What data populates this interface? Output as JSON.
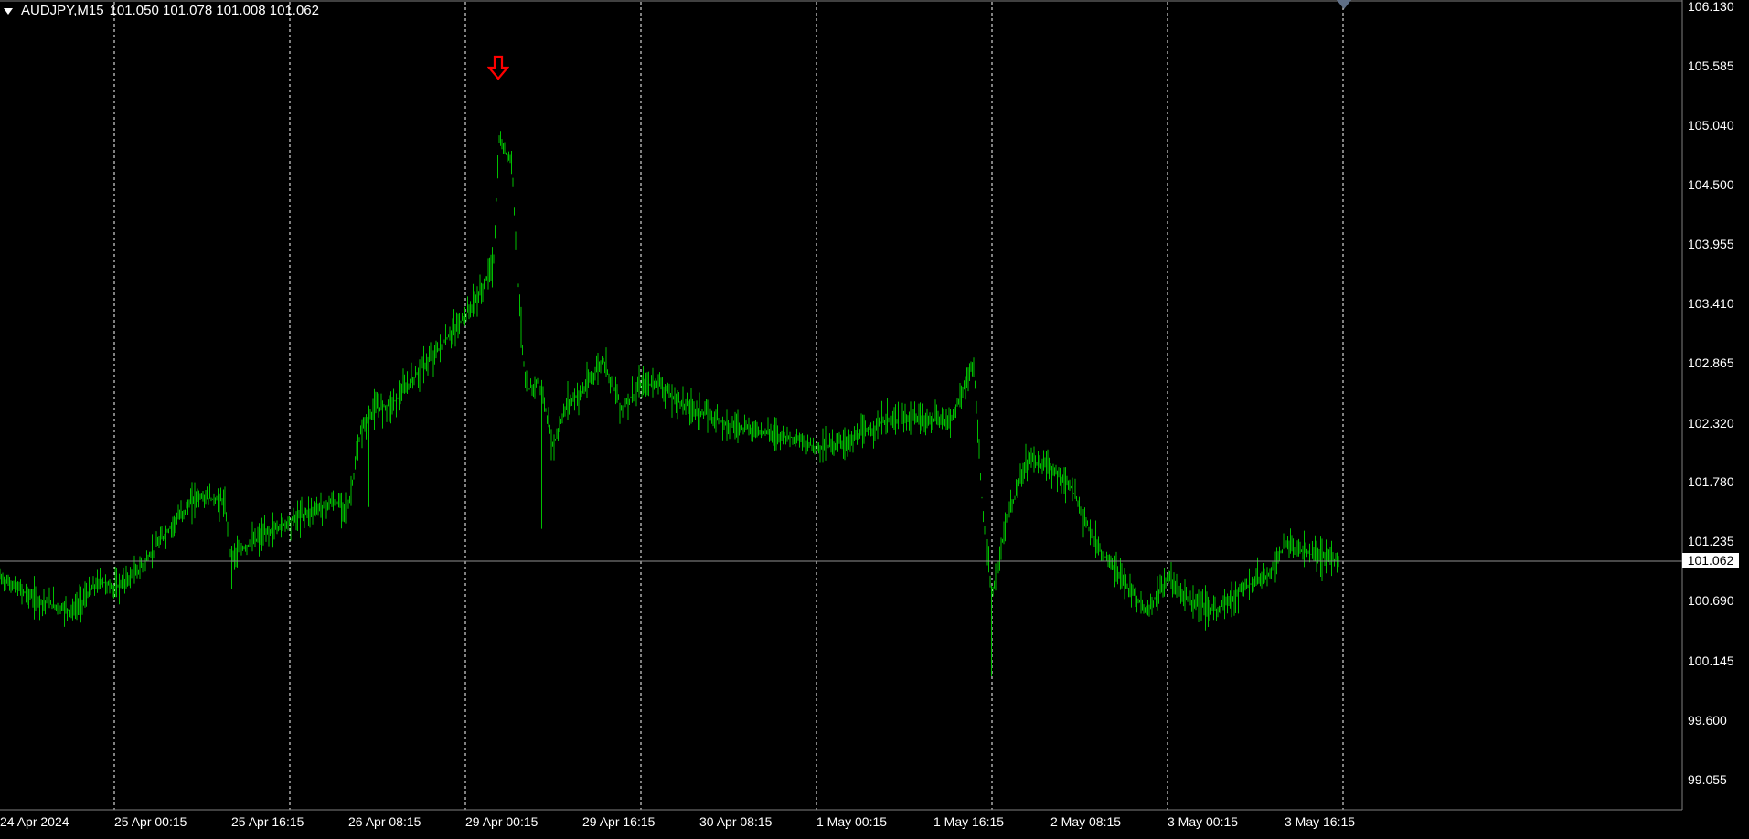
{
  "header": {
    "symbol_timeframe": "AUDJPY,M15",
    "ohlc": "101.050 101.078 101.008 101.062"
  },
  "current_price_label": "101.062",
  "y_axis_ticks": [
    "106.130",
    "105.585",
    "105.040",
    "104.500",
    "103.955",
    "103.410",
    "102.865",
    "102.320",
    "101.780",
    "101.235",
    "100.690",
    "100.145",
    "99.600",
    "99.055"
  ],
  "x_axis_ticks": [
    "24 Apr 2024",
    "25 Apr 00:15",
    "25 Apr 16:15",
    "26 Apr 08:15",
    "29 Apr 00:15",
    "29 Apr 16:15",
    "30 Apr 08:15",
    "1 May 00:15",
    "1 May 16:15",
    "2 May 08:15",
    "3 May 00:15",
    "3 May 16:15"
  ],
  "colors": {
    "background": "#000000",
    "bars": "#00c000",
    "grid": "#ffffff",
    "axis": "#7f7f7f",
    "sell_arrow": "#ff0000"
  },
  "icons": [
    "collapse-triangle-icon",
    "sell-arrow-down-icon",
    "shift-pointer-icon"
  ],
  "chart_data": {
    "type": "line",
    "symbol": "AUDJPY",
    "timeframe": "M15",
    "ylim": [
      99.055,
      106.13
    ],
    "grid": true,
    "x": [
      "24 Apr 2024",
      "25 Apr 00:15",
      "25 Apr 16:15",
      "26 Apr 08:15",
      "29 Apr 00:15",
      "29 Apr 16:15",
      "30 Apr 08:15",
      "1 May 00:15",
      "1 May 16:15",
      "2 May 08:15",
      "3 May 00:15",
      "3 May 16:15"
    ],
    "series": [
      {
        "values": [
          100.9,
          100.98,
          101.55,
          102.45,
          103.25,
          102.6,
          102.25,
          102.18,
          102.45,
          101.9,
          100.8,
          101.06
        ]
      }
    ],
    "high_points": [
      {
        "x": "29 Apr 00:15",
        "y": 104.95
      },
      {
        "x": "1 May 16:15",
        "y": 100.0
      }
    ]
  }
}
